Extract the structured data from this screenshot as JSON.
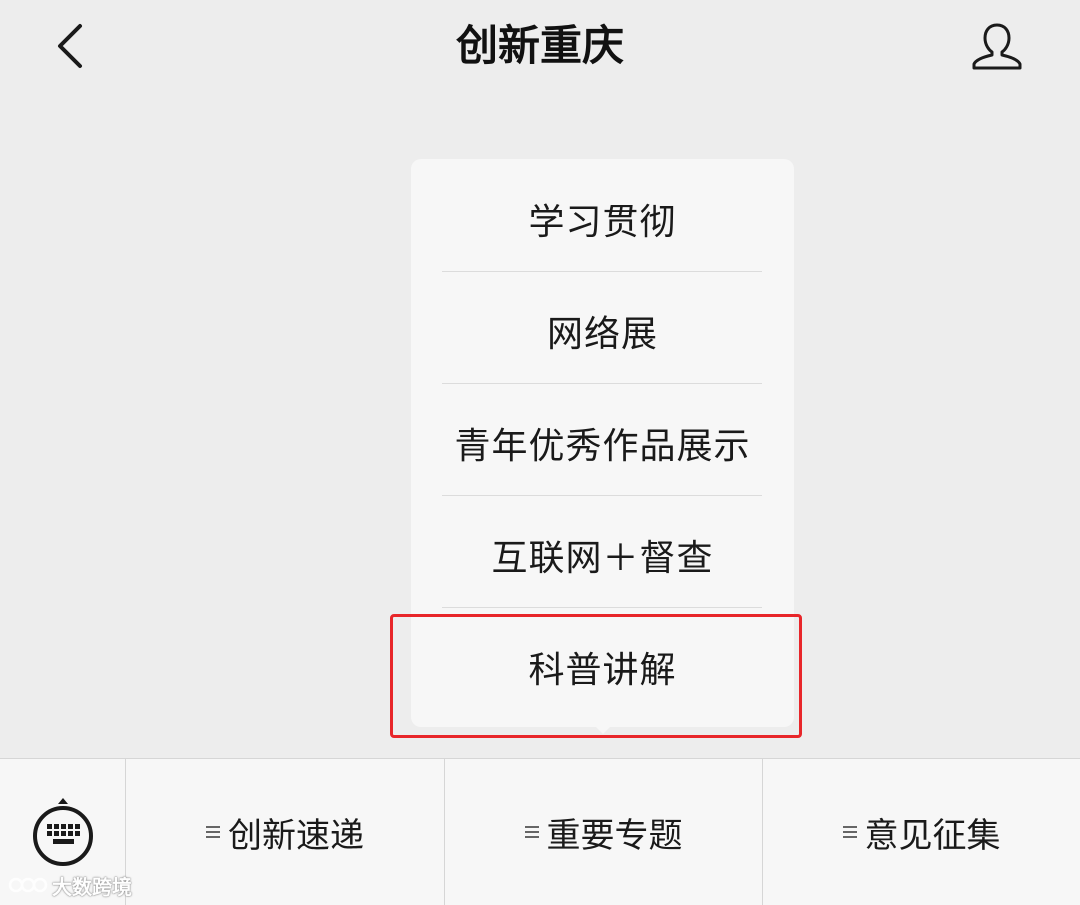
{
  "header": {
    "title": "创新重庆",
    "back_icon": "chevron-left-icon",
    "profile_icon": "person-outline-icon"
  },
  "popup_menu": {
    "items": [
      {
        "label": "学习贯彻"
      },
      {
        "label": "网络展"
      },
      {
        "label": "青年优秀作品展示"
      },
      {
        "label": "互联网＋督查"
      },
      {
        "label": "科普讲解"
      }
    ],
    "highlighted_index": 4,
    "highlight_color": "#e8262a"
  },
  "bottom_bar": {
    "keyboard_icon": "keyboard-icon",
    "tabs": [
      {
        "label": "创新速递"
      },
      {
        "label": "重要专题"
      },
      {
        "label": "意见征集"
      }
    ]
  },
  "watermark": {
    "text": "大数跨境"
  }
}
